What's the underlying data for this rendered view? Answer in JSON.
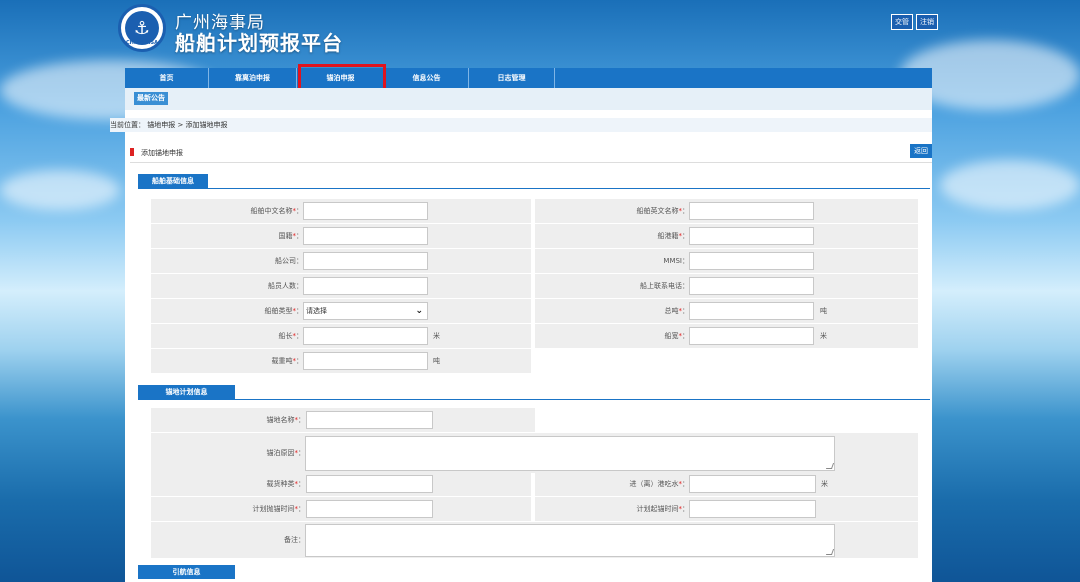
{
  "site": {
    "subtitle": "广州海事局",
    "title": "船舶计划预报平台",
    "logo_text": "CHINA MSA"
  },
  "top_links": [
    "交管",
    "注销"
  ],
  "nav": {
    "items": [
      "首页",
      "靠离泊申报",
      "锚泊申报",
      "信息公告",
      "日志管理"
    ],
    "active_index": 2
  },
  "notice_button": "最新公告",
  "breadcrumb": "当前位置： 锚地申报 > 添加锚地申报",
  "page_section": {
    "title": "添加锚地申报",
    "back": "返回"
  },
  "tabs": {
    "basic": "船舶基础信息",
    "plan": "锚地计划信息",
    "pilot": "引航信息"
  },
  "basic": {
    "cn_name": "船舶中文名称",
    "en_name": "船舶英文名称",
    "nationality": "国籍",
    "port": "船港籍",
    "company": "船公司",
    "mmsi": "MMSI",
    "crew": "船员人数",
    "phone": "船上联系电话",
    "type": "船舶类型",
    "type_value": "请选择",
    "gross": "总吨",
    "gross_unit": "吨",
    "length": "船长",
    "length_unit": "米",
    "width": "船宽",
    "width_unit": "米",
    "dwt": "载重吨",
    "dwt_unit": "吨"
  },
  "plan": {
    "anchorage": "锚地名称",
    "reason": "锚泊原因",
    "cargo": "载货种类",
    "draft": "进（离）港吃水",
    "draft_unit": "米",
    "anchor_time": "计划抛锚时间",
    "weigh_time": "计划起锚时间",
    "remark": "备注"
  },
  "required_mark": "*",
  "colon": "："
}
